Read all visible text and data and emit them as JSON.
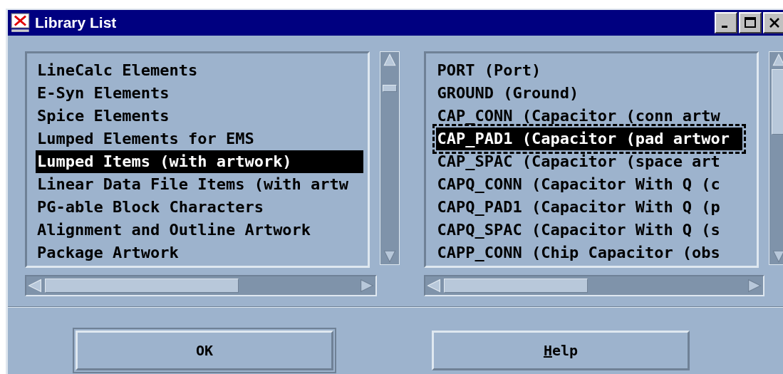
{
  "window": {
    "title": "Library List"
  },
  "libraries": {
    "items": [
      {
        "label": "LineCalc Elements",
        "selected": false,
        "focused": false
      },
      {
        "label": "E-Syn Elements",
        "selected": false,
        "focused": false
      },
      {
        "label": "Spice Elements",
        "selected": false,
        "focused": false
      },
      {
        "label": "Lumped Elements for EMS",
        "selected": false,
        "focused": false
      },
      {
        "label": "Lumped Items (with artwork)",
        "selected": true,
        "focused": false
      },
      {
        "label": "Linear Data File Items (with artw",
        "selected": false,
        "focused": false
      },
      {
        "label": "PG-able Block Characters",
        "selected": false,
        "focused": false
      },
      {
        "label": "Alignment and Outline Artwork",
        "selected": false,
        "focused": false
      },
      {
        "label": "Package Artwork",
        "selected": false,
        "focused": false
      }
    ]
  },
  "components": {
    "items": [
      {
        "label": "PORT (Port)",
        "selected": false,
        "focused": false
      },
      {
        "label": "GROUND (Ground)",
        "selected": false,
        "focused": false
      },
      {
        "label": "CAP_CONN (Capacitor (conn artw",
        "selected": false,
        "focused": false
      },
      {
        "label": "CAP_PAD1 (Capacitor (pad artwor",
        "selected": true,
        "focused": true
      },
      {
        "label": "CAP_SPAC (Capacitor (space art",
        "selected": false,
        "focused": false
      },
      {
        "label": "CAPQ_CONN (Capacitor With Q (c",
        "selected": false,
        "focused": false
      },
      {
        "label": "CAPQ_PAD1 (Capacitor With Q (p",
        "selected": false,
        "focused": false
      },
      {
        "label": "CAPQ_SPAC (Capacitor With Q (s",
        "selected": false,
        "focused": false
      },
      {
        "label": "CAPP_CONN (Chip Capacitor (obs",
        "selected": false,
        "focused": false
      }
    ]
  },
  "buttons": [
    {
      "label": "OK",
      "mnemonic_first": false
    },
    {
      "label": "Help",
      "mnemonic_first": true
    }
  ]
}
